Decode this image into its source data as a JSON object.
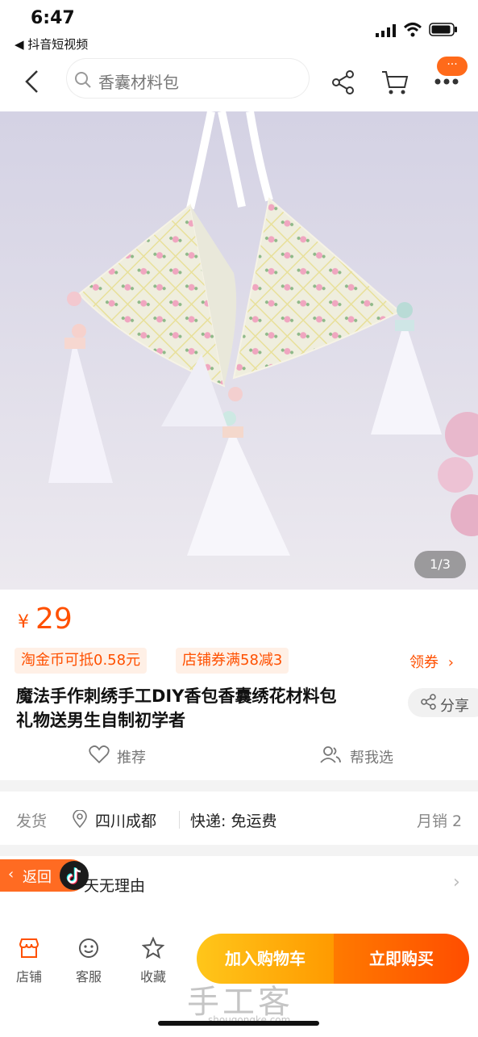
{
  "status_bar": {
    "time": "6:47",
    "back_app": "◀ 抖音短视频"
  },
  "header": {
    "search_text": "香囊材料包",
    "more_badge": "···",
    "icons": [
      "back-icon",
      "search-icon",
      "share-icon",
      "cart-icon",
      "more-icon"
    ]
  },
  "gallery": {
    "pager": "1/3"
  },
  "product": {
    "currency": "¥",
    "price": "29",
    "tags": [
      "淘金币可抵0.58元",
      "店铺券满58减3"
    ],
    "coupon_link": "领券",
    "title_line1": "魔法手作刺绣手工DIY香包香囊绣花材料包",
    "title_line2": "礼物送男生自制初学者",
    "share_label": "分享",
    "recommend_label": "推荐",
    "help_choose_label": "帮我选"
  },
  "shipping": {
    "label": "发货",
    "location": "四川成都",
    "express": "快递: 免运费",
    "monthly_sales": "月销 2"
  },
  "guarantee": {
    "text": "天无理由",
    "return_label": "返回"
  },
  "bottom_bar": {
    "shop_label": "店铺",
    "service_label": "客服",
    "favorite_label": "收藏",
    "add_to_cart": "加入购物车",
    "buy_now": "立即购买"
  },
  "watermark": {
    "text": "手工客",
    "url": "shougongke.com"
  },
  "colors": {
    "accent": "#ff5000",
    "cart_button": "#ffb300",
    "buy_button": "#ff6a00"
  }
}
